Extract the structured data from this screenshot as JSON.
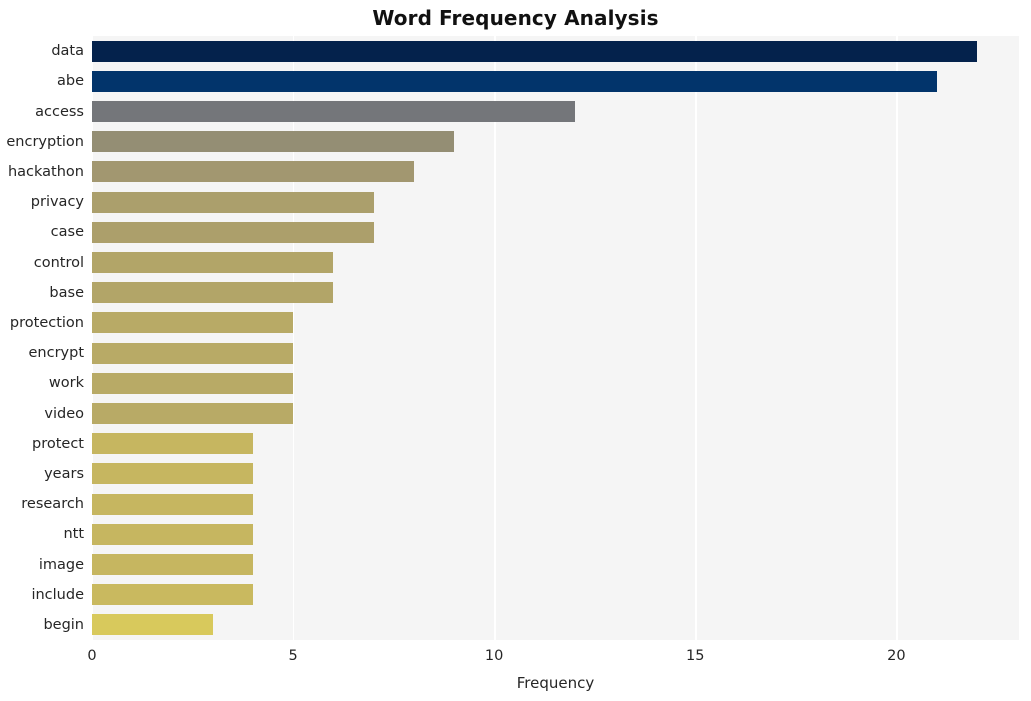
{
  "chart_data": {
    "type": "bar",
    "orientation": "horizontal",
    "title": "Word Frequency Analysis",
    "xlabel": "Frequency",
    "ylabel": "",
    "categories": [
      "data",
      "abe",
      "access",
      "encryption",
      "hackathon",
      "privacy",
      "case",
      "control",
      "base",
      "protection",
      "encrypt",
      "work",
      "video",
      "protect",
      "years",
      "research",
      "ntt",
      "image",
      "include",
      "begin"
    ],
    "values": [
      22,
      21,
      12,
      9,
      8,
      7,
      7,
      6,
      6,
      5,
      5,
      5,
      5,
      4,
      4,
      4,
      4,
      4,
      4,
      3
    ],
    "bar_colors": [
      "#04224c",
      "#02346b",
      "#74767a",
      "#948e74",
      "#a29770",
      "#ab9f6c",
      "#ac9f6b",
      "#b2a568",
      "#b2a568",
      "#b8aa66",
      "#b8aa66",
      "#b8aa66",
      "#b8aa66",
      "#c6b660",
      "#c6b660",
      "#c6b660",
      "#c6b660",
      "#c6b660",
      "#c9b95f",
      "#d8c95c"
    ],
    "xlim": [
      0,
      23.05
    ],
    "xticks": [
      0,
      5,
      10,
      15,
      20
    ],
    "xtick_labels": [
      "0",
      "5",
      "10",
      "15",
      "20"
    ],
    "gridlines": "vertical-white",
    "plot_background": "#f5f5f5",
    "figure_background": "#ffffff",
    "legend": "none"
  }
}
